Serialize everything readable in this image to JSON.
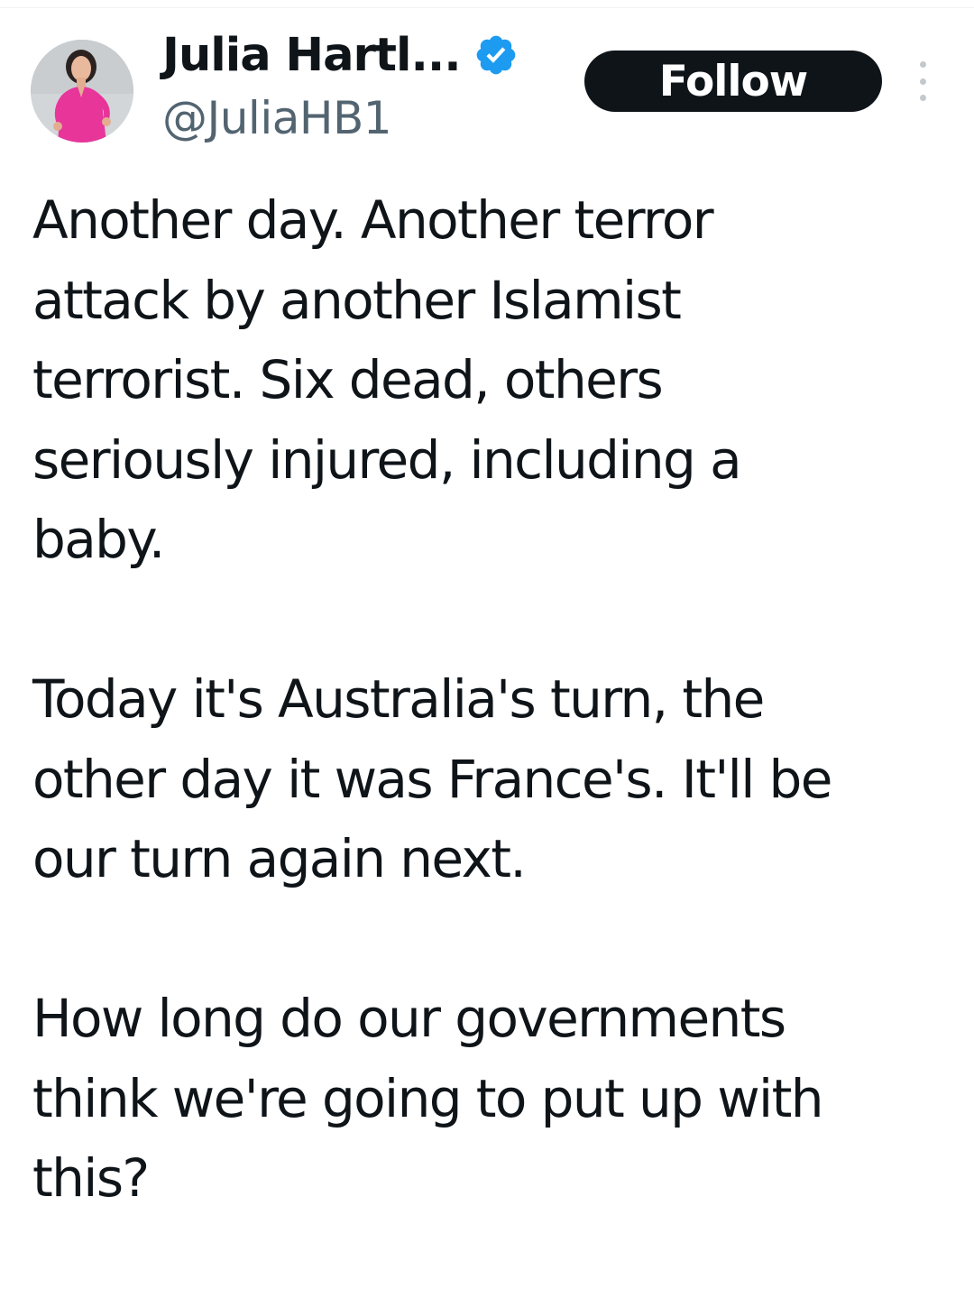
{
  "author": {
    "display_name": "Julia Hartl...",
    "handle": "@JuliaHB1",
    "verified": true
  },
  "actions": {
    "follow_label": "Follow"
  },
  "tweet": {
    "paragraphs": [
      [
        "Another day. Another terror",
        "attack by another Islamist",
        "terrorist. Six dead, others",
        "seriously injured, including a",
        "baby."
      ],
      [
        "Today it's Australia's turn, the",
        "other day it was France's. It'll be",
        "our turn again next."
      ],
      [
        "How long do our governments",
        "think we're going to put up with",
        "this?"
      ]
    ]
  },
  "colors": {
    "text": "#0f1419",
    "secondary_text": "#536471",
    "verified_badge": "#1d9bf0",
    "follow_button_bg": "#0f1419",
    "avatar_dress": "#e8359a"
  },
  "icons": {
    "verified": "verified-badge-icon",
    "more": "more-dots-icon"
  }
}
